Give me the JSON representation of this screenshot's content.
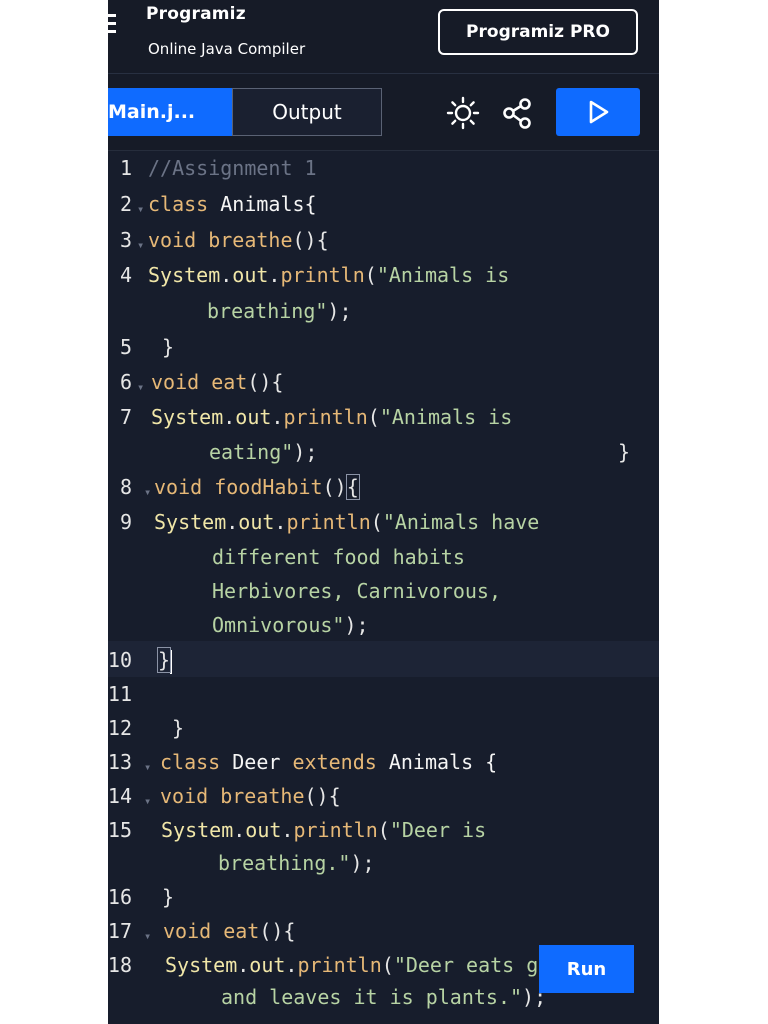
{
  "header": {
    "brand": "Programiz",
    "subtitle": "Online Java Compiler",
    "pro_button": "Programiz PRO"
  },
  "toolbar": {
    "tab_main": "Main.j...",
    "tab_output": "Output",
    "icons": [
      "menu-icon",
      "sun-icon",
      "share-icon",
      "play-icon"
    ]
  },
  "editor": {
    "line_numbers": [
      "1",
      "2",
      "3",
      "4",
      "5",
      "6",
      "7",
      "8",
      "9",
      "10",
      "11",
      "12",
      "13",
      "14",
      "15",
      "16",
      "17",
      "18"
    ],
    "code": [
      "//Assignment 1",
      "class Animals{",
      "void breathe(){",
      "System.out.println(\"Animals is breathing\");",
      " }",
      "void eat(){",
      "System.out.println(\"Animals is eating\");",
      "void foodHabit(){",
      "System.out.println(\"Animals have different food habits Herbivores, Carnivorous, Omnivorous\");",
      "}",
      "",
      " }",
      "class Deer extends Animals {",
      "void breathe(){",
      "System.out.println(\"Deer is breathing.\");",
      "}",
      "void eat(){",
      "System.out.println(\"Deer eats grass and leaves it is plants.\");"
    ],
    "stray_brace": "}"
  },
  "run_button": "Run",
  "colors": {
    "background": "#171d2c",
    "accent": "#0f6bff",
    "keyword": "#e6b877",
    "string": "#b7d3a4",
    "comment": "#6b7386"
  }
}
